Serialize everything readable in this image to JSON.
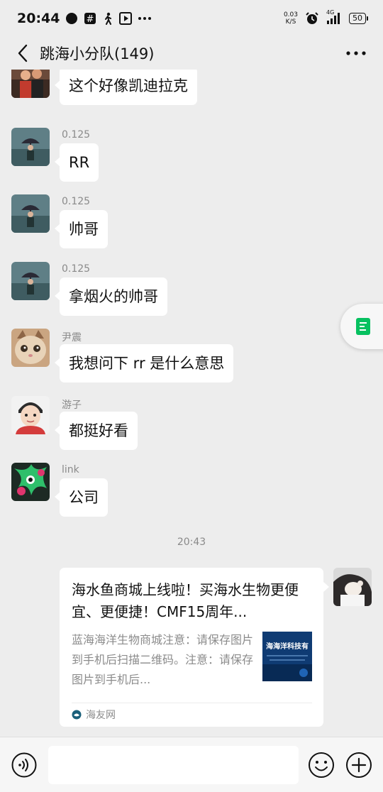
{
  "status_bar": {
    "time": "20:44",
    "speed_top": "0.03",
    "speed_unit": "K/S",
    "network": "4G",
    "battery": "50"
  },
  "header": {
    "title": "跳海小分队(149)"
  },
  "messages": [
    {
      "sender": "",
      "text": "这个好像凯迪拉克",
      "avatar": "photo-avatar-couple"
    },
    {
      "sender": "0.125",
      "text": "RR",
      "avatar": "umbrella-avatar"
    },
    {
      "sender": "0.125",
      "text": "帅哥",
      "avatar": "umbrella-avatar"
    },
    {
      "sender": "0.125",
      "text": "拿烟火的帅哥",
      "avatar": "umbrella-avatar"
    },
    {
      "sender": "尹震",
      "text": "我想问下 rr 是什么意思",
      "avatar": "cat-avatar"
    },
    {
      "sender": "游子",
      "text": "都挺好看",
      "avatar": "cartoon-boy-avatar"
    },
    {
      "sender": "link",
      "text": "公司",
      "avatar": "splatoon-avatar"
    }
  ],
  "timestamp": "20:43",
  "link_card": {
    "title": "海水鱼商城上线啦！买海水生物更便宜、更便捷！CMF15周年...",
    "description": "蓝海海洋生物商城注意：请保存图片到手机后扫描二维码。注意：请保存图片到手机后...",
    "thumb_text": "海海洋科技有",
    "source": "海友网"
  },
  "colors": {
    "background": "#ededed",
    "bubble": "#ffffff",
    "meta_text": "#8a8a8a",
    "accent_green": "#07c160"
  }
}
